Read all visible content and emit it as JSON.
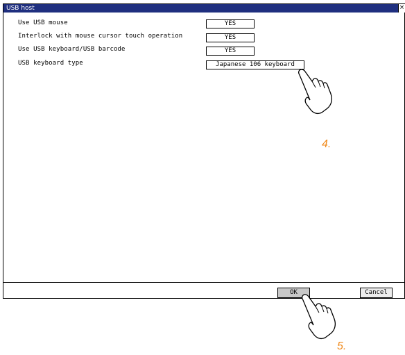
{
  "window": {
    "title": "USB host",
    "close_label": "×"
  },
  "settings": [
    {
      "label": "Use USB mouse",
      "value": "YES"
    },
    {
      "label": "Interlock with mouse cursor touch operation",
      "value": "YES"
    },
    {
      "label": "Use USB keyboard/USB barcode",
      "value": "YES"
    },
    {
      "label": "USB keyboard type",
      "value": "Japanese 106 keyboard"
    }
  ],
  "footer": {
    "ok_label": "OK",
    "cancel_label": "Cancel"
  },
  "annotations": {
    "step4": "4.",
    "step5": "5."
  },
  "colors": {
    "titlebar": "#1f2f7f",
    "step_marker": "#f08a1c",
    "ok_button": "#c8c8c8"
  },
  "icons": {
    "pointer": "pointing-hand-icon"
  }
}
